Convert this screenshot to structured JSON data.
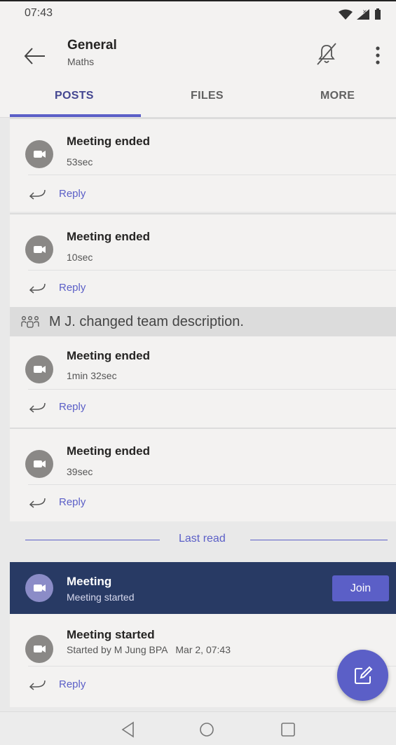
{
  "status_bar": {
    "time": "07:43"
  },
  "header": {
    "channel": "General",
    "team": "Maths"
  },
  "tabs": [
    {
      "label": "POSTS"
    },
    {
      "label": "FILES"
    },
    {
      "label": "MORE"
    }
  ],
  "feed": {
    "cards": [
      {
        "title": "Meeting ended",
        "duration": "53sec",
        "reply": "Reply"
      },
      {
        "title": "Meeting ended",
        "duration": "10sec",
        "reply": "Reply"
      },
      {
        "title": "Meeting ended",
        "duration": "1min 32sec",
        "reply": "Reply"
      },
      {
        "title": "Meeting ended",
        "duration": "39sec",
        "reply": "Reply"
      }
    ],
    "system_message": "M J. changed team description.",
    "last_read": "Last read",
    "live_meeting": {
      "title": "Meeting",
      "subtitle": "Meeting started",
      "join": "Join"
    },
    "started_card": {
      "title": "Meeting started",
      "detail": "Started by M Jung BPA   Mar 2, 07:43",
      "reply": "Reply"
    }
  },
  "icons": {
    "back": "arrow-left-icon",
    "mute": "bell-off-icon",
    "more": "more-vertical-icon",
    "meeting": "video-call-icon",
    "reply": "reply-icon",
    "team": "team-people-icon",
    "compose": "compose-icon"
  },
  "colors": {
    "accent": "#5b5fc7",
    "live_banner": "#283a64",
    "header_bg": "#f3f2f1"
  }
}
